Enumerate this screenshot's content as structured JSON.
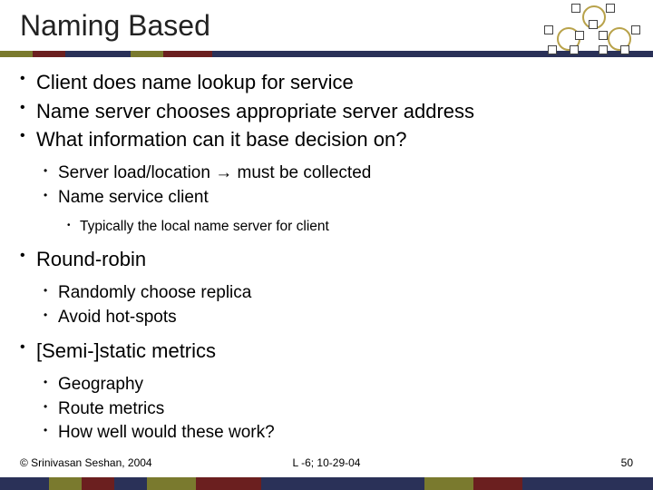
{
  "title": "Naming Based",
  "bullets": {
    "l1a": "Client does name lookup for service",
    "l1b": "Name server chooses appropriate server address",
    "l1c": "What information can it base decision on?",
    "l2a": "Server load/location → must be collected",
    "l2b": "Name service client",
    "l3a": "Typically the local name server for client",
    "l1d": "Round-robin",
    "l2c": "Randomly choose replica",
    "l2d": "Avoid hot-spots",
    "l1e": "[Semi-]static metrics",
    "l2e": "Geography",
    "l2f": "Route metrics",
    "l2g": "How well would these work?"
  },
  "footer": {
    "left": "© Srinivasan Seshan, 2004",
    "center": "L -6; 10-29-04",
    "right": "50"
  }
}
